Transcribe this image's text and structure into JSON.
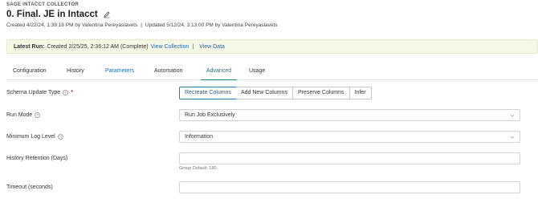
{
  "header": {
    "eyebrow": "SAGE INTACCT COLLECTOR",
    "title": "0. Final. JE in Intacct",
    "created": "Created 4/22/24, 1:39:18 PM by Valentina Pereyaslavets",
    "separator": "|",
    "updated": "Updated 5/12/24, 3:13:00 PM by Valentina Pereyaslavets"
  },
  "latest_run": {
    "label": "Latest Run:",
    "text": "Created 2/25/25, 2:36:12 AM (Complete)",
    "view_collection": "View Collection",
    "separator": "|",
    "view_data": "View Data"
  },
  "tabs": [
    {
      "label": "Configuration"
    },
    {
      "label": "History"
    },
    {
      "label": "Parameters"
    },
    {
      "label": "Automation"
    },
    {
      "label": "Advanced"
    },
    {
      "label": "Usage"
    }
  ],
  "active_tab": "Advanced",
  "form": {
    "schema_update_type": {
      "label": "Schema Update Type",
      "required_mark": "*",
      "options": [
        "Recreate Columns",
        "Add New Columns",
        "Preserve Columns",
        "Infer"
      ],
      "selected": "Recreate Columns"
    },
    "run_mode": {
      "label": "Run Mode",
      "value": "Run Job Exclusively"
    },
    "minimum_log_level": {
      "label": "Minimum Log Level",
      "value": "Information"
    },
    "history_retention": {
      "label": "History Retention (Days)",
      "value": "",
      "hint": "Group Default: 180"
    },
    "timeout": {
      "label": "Timeout (seconds)",
      "value": ""
    }
  },
  "colors": {
    "accent": "#2b7fb8",
    "active_tab_underline": "#2a8a7a",
    "banner_bg": "#f5f8e6",
    "required": "#d0352b"
  }
}
